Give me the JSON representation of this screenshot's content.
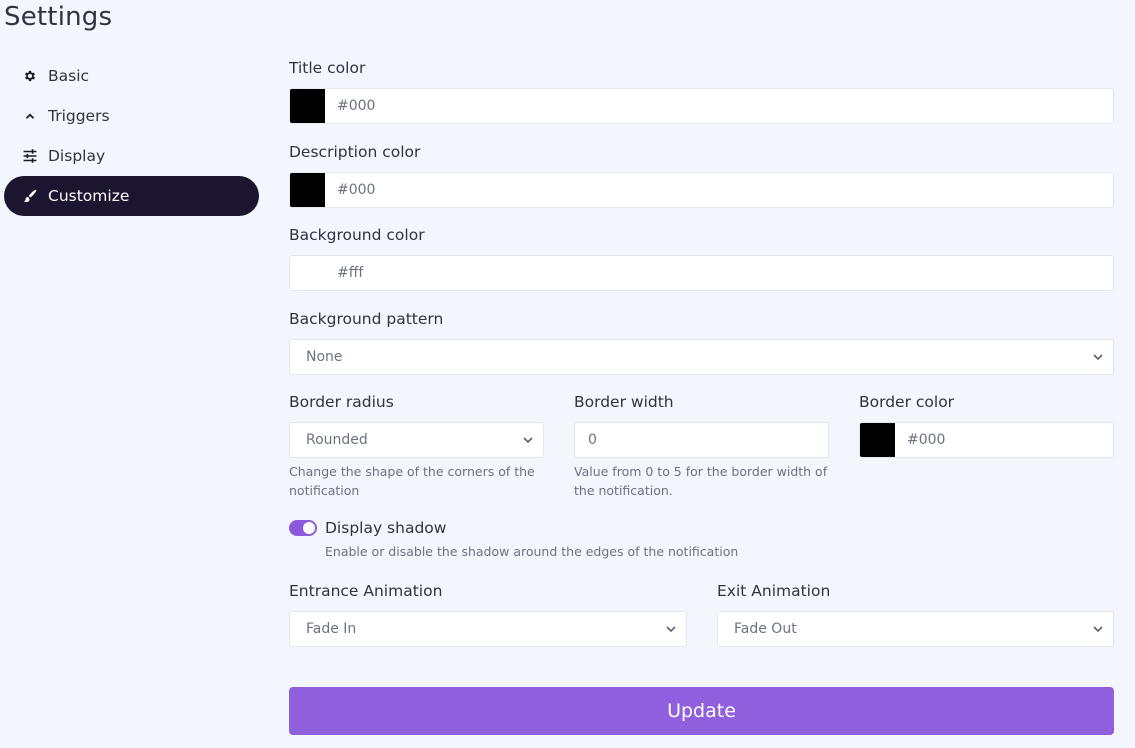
{
  "page": {
    "title": "Settings"
  },
  "sidebar": {
    "items": [
      {
        "label": "Basic",
        "icon": "gear-icon",
        "active": false
      },
      {
        "label": "Triggers",
        "icon": "chevron-up-icon",
        "active": false
      },
      {
        "label": "Display",
        "icon": "sliders-icon",
        "active": false
      },
      {
        "label": "Customize",
        "icon": "paintbrush-icon",
        "active": true
      }
    ]
  },
  "form": {
    "title_color": {
      "label": "Title color",
      "value": "#000",
      "swatch": "#000000"
    },
    "description_color": {
      "label": "Description color",
      "value": "#000",
      "swatch": "#000000"
    },
    "background_color": {
      "label": "Background color",
      "value": "#fff",
      "swatch": "#ffffff"
    },
    "background_pattern": {
      "label": "Background pattern",
      "value": "None"
    },
    "border_radius": {
      "label": "Border radius",
      "value": "Rounded",
      "help": "Change the shape of the corners of the notification"
    },
    "border_width": {
      "label": "Border width",
      "value": "0",
      "help": "Value from 0 to 5 for the border width of the notification."
    },
    "border_color": {
      "label": "Border color",
      "value": "#000",
      "swatch": "#000000"
    },
    "display_shadow": {
      "label": "Display shadow",
      "enabled": true,
      "help": "Enable or disable the shadow around the edges of the notification"
    },
    "entrance_animation": {
      "label": "Entrance Animation",
      "value": "Fade In"
    },
    "exit_animation": {
      "label": "Exit Animation",
      "value": "Fade Out"
    }
  },
  "actions": {
    "update_label": "Update"
  },
  "colors": {
    "accent": "#8f5fde",
    "active_nav": "#1c1530",
    "background": "#f3f6fc"
  }
}
